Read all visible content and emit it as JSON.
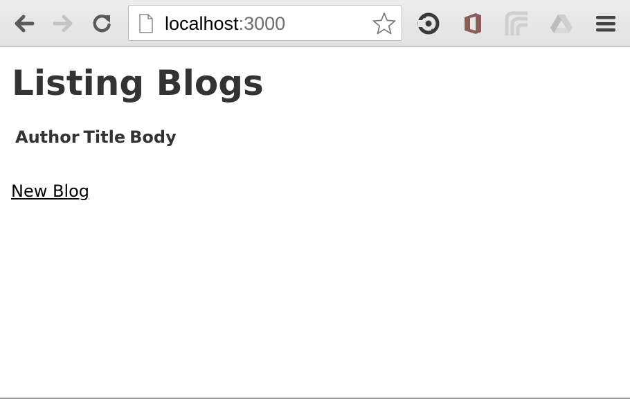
{
  "browser": {
    "url_host": "localhost",
    "url_port": ":3000",
    "icons": {
      "back": "arrow-left-icon",
      "forward": "arrow-right-icon",
      "reload": "reload-icon",
      "page": "page-icon",
      "bookmark": "star-icon",
      "ext1": "sync-extension-icon",
      "ext2": "office-extension-icon",
      "ext3": "cast-extension-icon",
      "ext4": "drive-extension-icon",
      "menu": "hamburger-menu-icon"
    }
  },
  "page": {
    "title": "Listing Blogs",
    "table": {
      "headers": [
        "Author",
        "Title",
        "Body"
      ]
    },
    "new_link": "New Blog"
  },
  "colors": {
    "text": "#333333",
    "link": "#000000",
    "toolbar": "#e6e6e6"
  }
}
